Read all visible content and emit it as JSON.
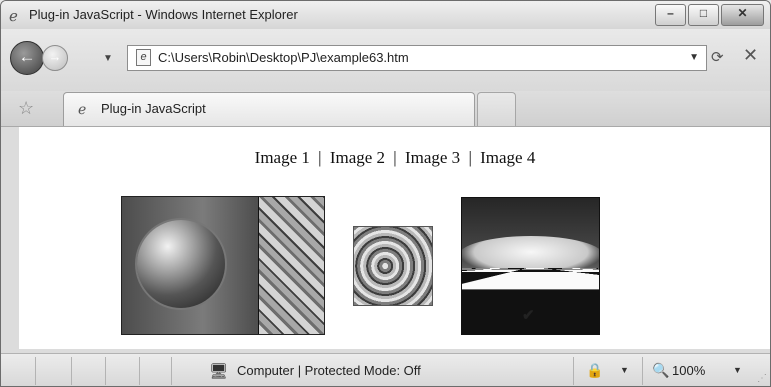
{
  "window": {
    "title": "Plug-in JavaScript - Windows Internet Explorer",
    "app_icon": "ie-logo-icon",
    "minimize_glyph": "–",
    "maximize_glyph": "□",
    "close_glyph": "✕"
  },
  "nav": {
    "back_glyph": "←",
    "forward_glyph": "→",
    "history_dropdown_glyph": "▼",
    "address": "C:\\Users\\Robin\\Desktop\\PJ\\example63.htm",
    "address_dropdown_glyph": "▼",
    "refresh_glyph": "⟳",
    "stop_glyph": "✕"
  },
  "tabs": [
    {
      "label": "Plug-in JavaScript",
      "icon": "ie-logo-icon"
    }
  ],
  "favorites_glyph": "☆",
  "content": {
    "image_links": [
      "Image 1",
      "Image 2",
      "Image 3",
      "Image 4"
    ],
    "separator": "|",
    "check_glyph": "✔"
  },
  "status": {
    "zone": "Computer | Protected Mode: Off",
    "computer_icon_glyph": "🖥",
    "security_glyph": "🔒",
    "security_dropdown_glyph": "▼",
    "zoom_glyph": "🔍",
    "zoom": "100%",
    "zoom_dropdown_glyph": "▼",
    "grip_glyph": "⋰"
  },
  "colors": {
    "chrome": "#dcdcdc",
    "content_bg": "#ffffff",
    "frame": "#6c6c6c"
  }
}
